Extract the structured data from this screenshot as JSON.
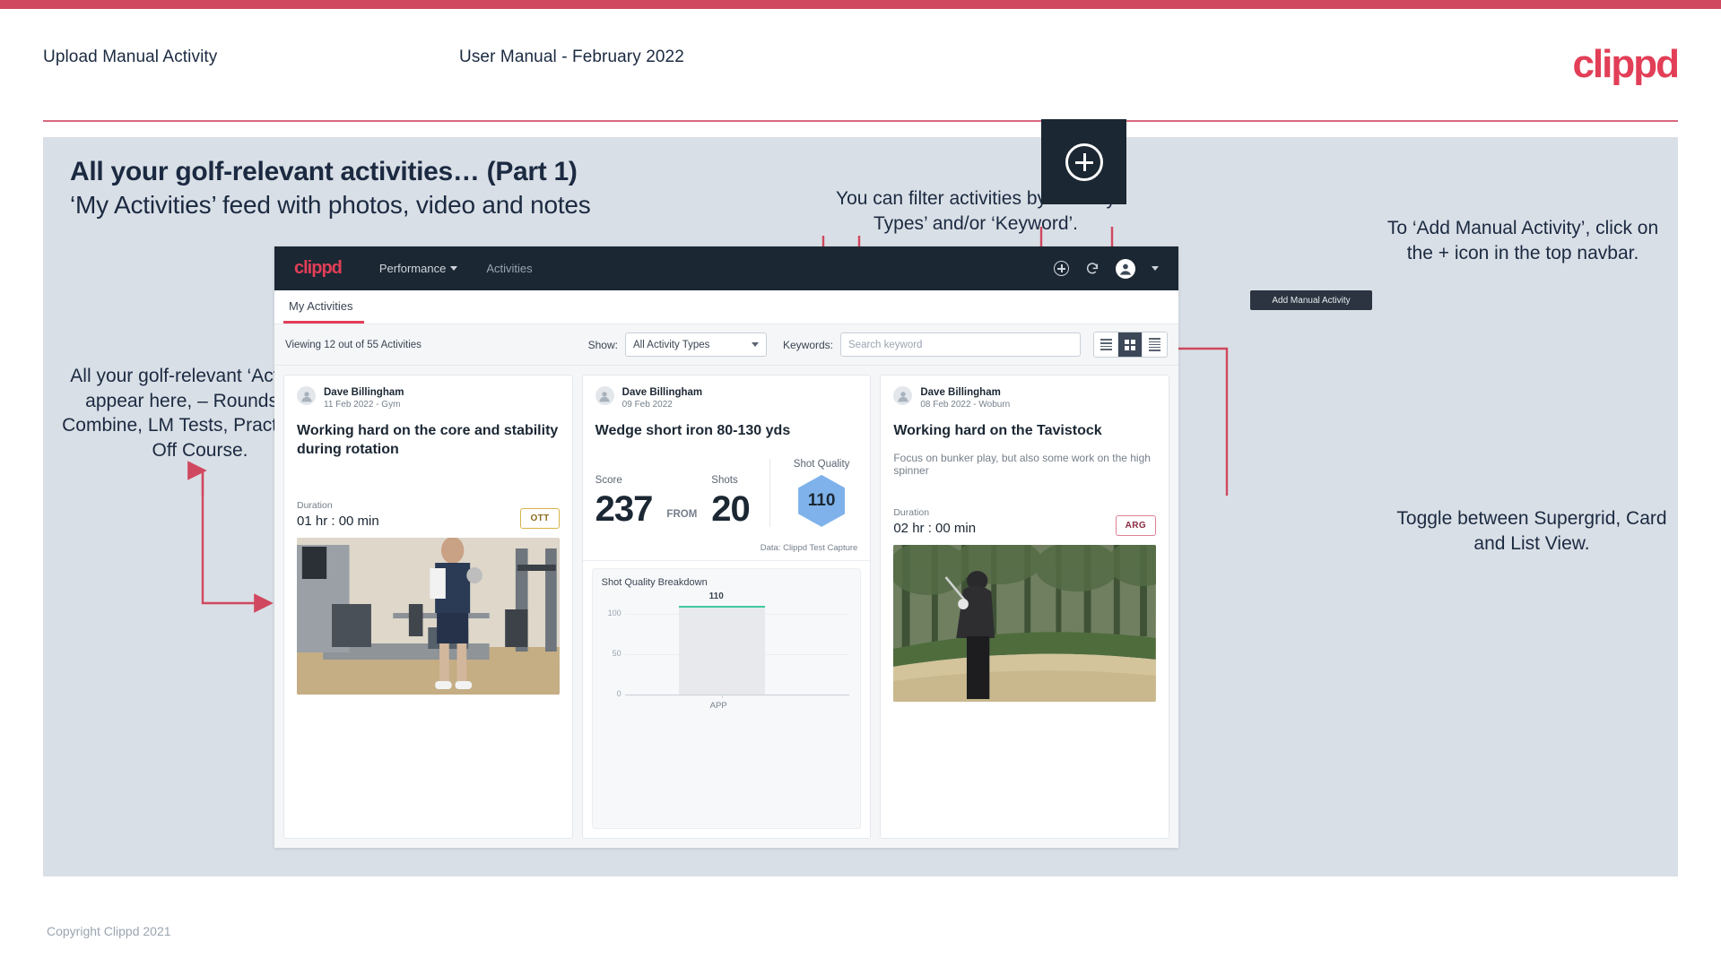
{
  "header": {
    "left_title": "Upload Manual Activity",
    "center_title": "User Manual - February 2022",
    "logo": "clippd"
  },
  "slide": {
    "title": "All your golf-relevant activities… (Part 1)",
    "subtitle": "‘My Activities’ feed with photos, video and notes"
  },
  "annotations": {
    "filter": "You can filter activities by ‘Activity Types’ and/or ‘Keyword’.",
    "add_manual": "To ‘Add Manual Activity’, click on the + icon in the top navbar.",
    "activities_feed": "All your golf-relevant ‘Activities’ appear here, – Rounds, LM Combine, LM Tests, Practice and Off Course.",
    "toggle_views": "Toggle between Supergrid, Card and List View."
  },
  "app": {
    "navbar": {
      "logo": "clippd",
      "links": [
        {
          "label": "Performance",
          "has_caret": true
        },
        {
          "label": "Activities",
          "has_caret": false
        }
      ],
      "icons": [
        "add-circle-icon",
        "refresh-icon",
        "account-icon",
        "chevron-down-icon"
      ],
      "tooltip": "Add Manual Activity"
    },
    "tabs": [
      {
        "label": "My Activities",
        "active": true
      }
    ],
    "filter_bar": {
      "viewing_prefix": "Viewing ",
      "viewing_count": "12",
      "viewing_middle": " out of ",
      "viewing_total": "55 Activities",
      "viewing_full": "Viewing 12 out of 55 Activities",
      "show_label": "Show:",
      "activity_type_value": "All Activity Types",
      "keywords_label": "Keywords:",
      "keyword_placeholder": "Search keyword",
      "views": [
        "list-view",
        "supergrid-view",
        "card-view"
      ],
      "active_view": "supergrid-view"
    },
    "cards": [
      {
        "user": "Dave Billingham",
        "meta": "11 Feb 2022 - Gym",
        "title": "Working hard on the core and stability during rotation",
        "duration_label": "Duration",
        "duration_value": "01 hr : 00 min",
        "tag": "OTT",
        "photo": "gym-video-thumbnail"
      },
      {
        "user": "Dave Billingham",
        "meta": "09 Feb 2022",
        "title": "Wedge short iron 80-130 yds",
        "score_label": "Score",
        "score_value": "237",
        "from_label": "FROM",
        "shots_label": "Shots",
        "shots_value": "20",
        "shot_quality_label": "Shot Quality",
        "shot_quality_value": "110",
        "data_source": "Data: Clippd Test Capture"
      },
      {
        "user": "Dave Billingham",
        "meta": "08 Feb 2022 - Woburn",
        "title": "Working hard on the Tavistock",
        "note": "Focus on bunker play, but also some work on the high spinner",
        "duration_label": "Duration",
        "duration_value": "02 hr : 00 min",
        "tag": "ARG",
        "photo": "bunker-shot-photo"
      }
    ]
  },
  "chart_data": {
    "type": "bar",
    "title": "Shot Quality Breakdown",
    "categories": [
      "APP"
    ],
    "values": [
      110
    ],
    "data_labels": [
      "110"
    ],
    "ytick_labels": [
      "100",
      "50",
      "0"
    ],
    "ylim": [
      0,
      120
    ],
    "xlabel": "",
    "ylabel": "",
    "grid": true,
    "legend": "none",
    "bar_color": "#e7e9ec",
    "bar_cap_color": "#3fc8a0"
  },
  "footer": {
    "copyright": "Copyright Clippd 2021"
  },
  "colors": {
    "brand_red": "#e23e57",
    "top_bar": "#d0485f",
    "slide_bg": "#d9dfe6",
    "navy": "#1b2733",
    "annotation_arrow": "#d0485f"
  }
}
